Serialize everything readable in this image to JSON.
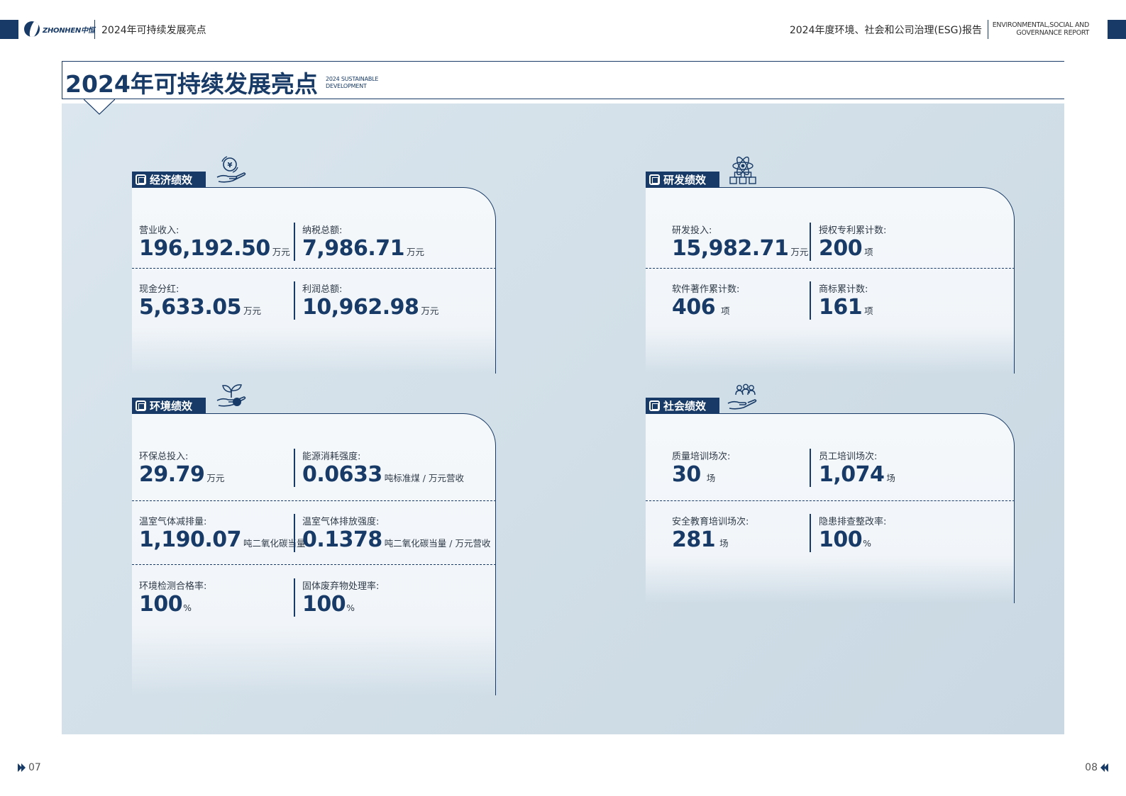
{
  "header": {
    "logo_text": "ZHONHEN中恒",
    "left_title": "2024年可持续发展亮点",
    "right_title": "2024年度环境、社会和公司治理(ESG)报告",
    "right_en_line1": "ENVIRONMENTAL,SOCIAL AND",
    "right_en_line2": "GOVERNANCE REPORT"
  },
  "title": {
    "main": "2024年可持续发展亮点",
    "en_line1": "2024 SUSTAINABLE",
    "en_line2": "DEVELOPMENT"
  },
  "cards": {
    "economic": {
      "heading": "经济绩效",
      "icon": "money-hand-icon",
      "items": [
        {
          "label": "营业收入:",
          "value": "196,192.50",
          "unit": "万元"
        },
        {
          "label": "纳税总额:",
          "value": "7,986.71",
          "unit": "万元"
        },
        {
          "label": "现金分红:",
          "value": "5,633.05",
          "unit": "万元"
        },
        {
          "label": "利润总额:",
          "value": "10,962.98",
          "unit": "万元"
        }
      ]
    },
    "rnd": {
      "heading": "研发绩效",
      "icon": "atom-cubes-icon",
      "items": [
        {
          "label": "研发投入:",
          "value": "15,982.71",
          "unit": "万元"
        },
        {
          "label": "授权专利累计数:",
          "value": "200",
          "unit": "项"
        },
        {
          "label": "软件著作累计数:",
          "value": "406",
          "unit": "项"
        },
        {
          "label": "商标累计数:",
          "value": "161",
          "unit": "项"
        }
      ]
    },
    "environment": {
      "heading": "环境绩效",
      "icon": "plant-hand-icon",
      "items": [
        {
          "label": "环保总投入:",
          "value": "29.79",
          "unit": "万元"
        },
        {
          "label": "能源消耗强度:",
          "value": "0.0633",
          "unit": "吨标准煤 / 万元营收"
        },
        {
          "label": "温室气体减排量:",
          "value": "1,190.07",
          "unit": "吨二氧化碳当量"
        },
        {
          "label": "温室气体排放强度:",
          "value": "0.1378",
          "unit": "吨二氧化碳当量 / 万元营收"
        },
        {
          "label": "环境检测合格率:",
          "value": "100",
          "unit": "%"
        },
        {
          "label": "固体废弃物处理率:",
          "value": "100",
          "unit": "%"
        }
      ]
    },
    "social": {
      "heading": "社会绩效",
      "icon": "people-hand-icon",
      "items": [
        {
          "label": "质量培训场次:",
          "value": "30",
          "unit": "场"
        },
        {
          "label": "员工培训场次:",
          "value": "1,074",
          "unit": "场"
        },
        {
          "label": "安全教育培训场次:",
          "value": "281",
          "unit": "场"
        },
        {
          "label": "隐患排查整改率:",
          "value": "100",
          "unit": "%"
        }
      ]
    }
  },
  "footer": {
    "page_left": "07",
    "page_right": "08"
  },
  "colors": {
    "brand": "#173a66",
    "panel": "#d2dfe8",
    "card": "#f3f6f9"
  }
}
